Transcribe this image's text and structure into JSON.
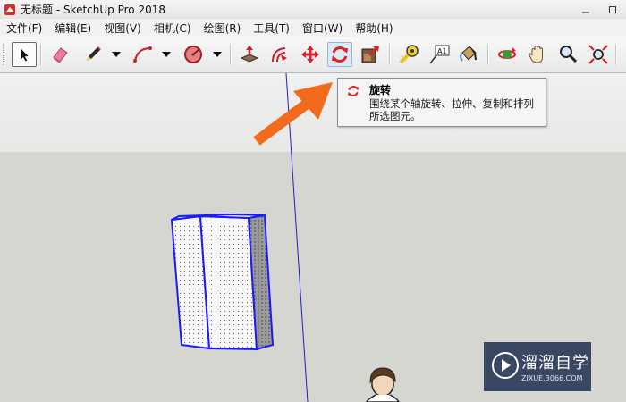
{
  "window": {
    "title": "无标题 - SketchUp Pro 2018"
  },
  "menu": [
    {
      "label": "文件(F)"
    },
    {
      "label": "编辑(E)"
    },
    {
      "label": "视图(V)"
    },
    {
      "label": "相机(C)"
    },
    {
      "label": "绘图(R)"
    },
    {
      "label": "工具(T)"
    },
    {
      "label": "窗口(W)"
    },
    {
      "label": "帮助(H)"
    }
  ],
  "toolbar": {
    "tools": [
      "select-tool",
      "eraser-tool",
      "pencil-tool",
      "arc-tool",
      "shape-tool",
      "push-pull-tool",
      "offset-tool",
      "move-tool",
      "rotate-tool",
      "scale-tool",
      "tape-measure-tool",
      "text-tool",
      "paint-bucket-tool",
      "orbit-tool",
      "pan-tool",
      "zoom-tool",
      "zoom-extents-tool"
    ],
    "active_tool": "select-tool",
    "hovered_tool": "rotate-tool",
    "text_tool_glyph": "A1"
  },
  "tooltip": {
    "title": "旋转",
    "description": "围绕某个轴旋转、拉伸、复制和排列所选图元。"
  },
  "watermark": {
    "name": "溜溜自学",
    "url": "ZIXUE.3066.COM"
  },
  "colors": {
    "accent_orange": "#f26a1b",
    "selection_blue": "#1a1aff",
    "rotate_red": "#d7232a"
  }
}
